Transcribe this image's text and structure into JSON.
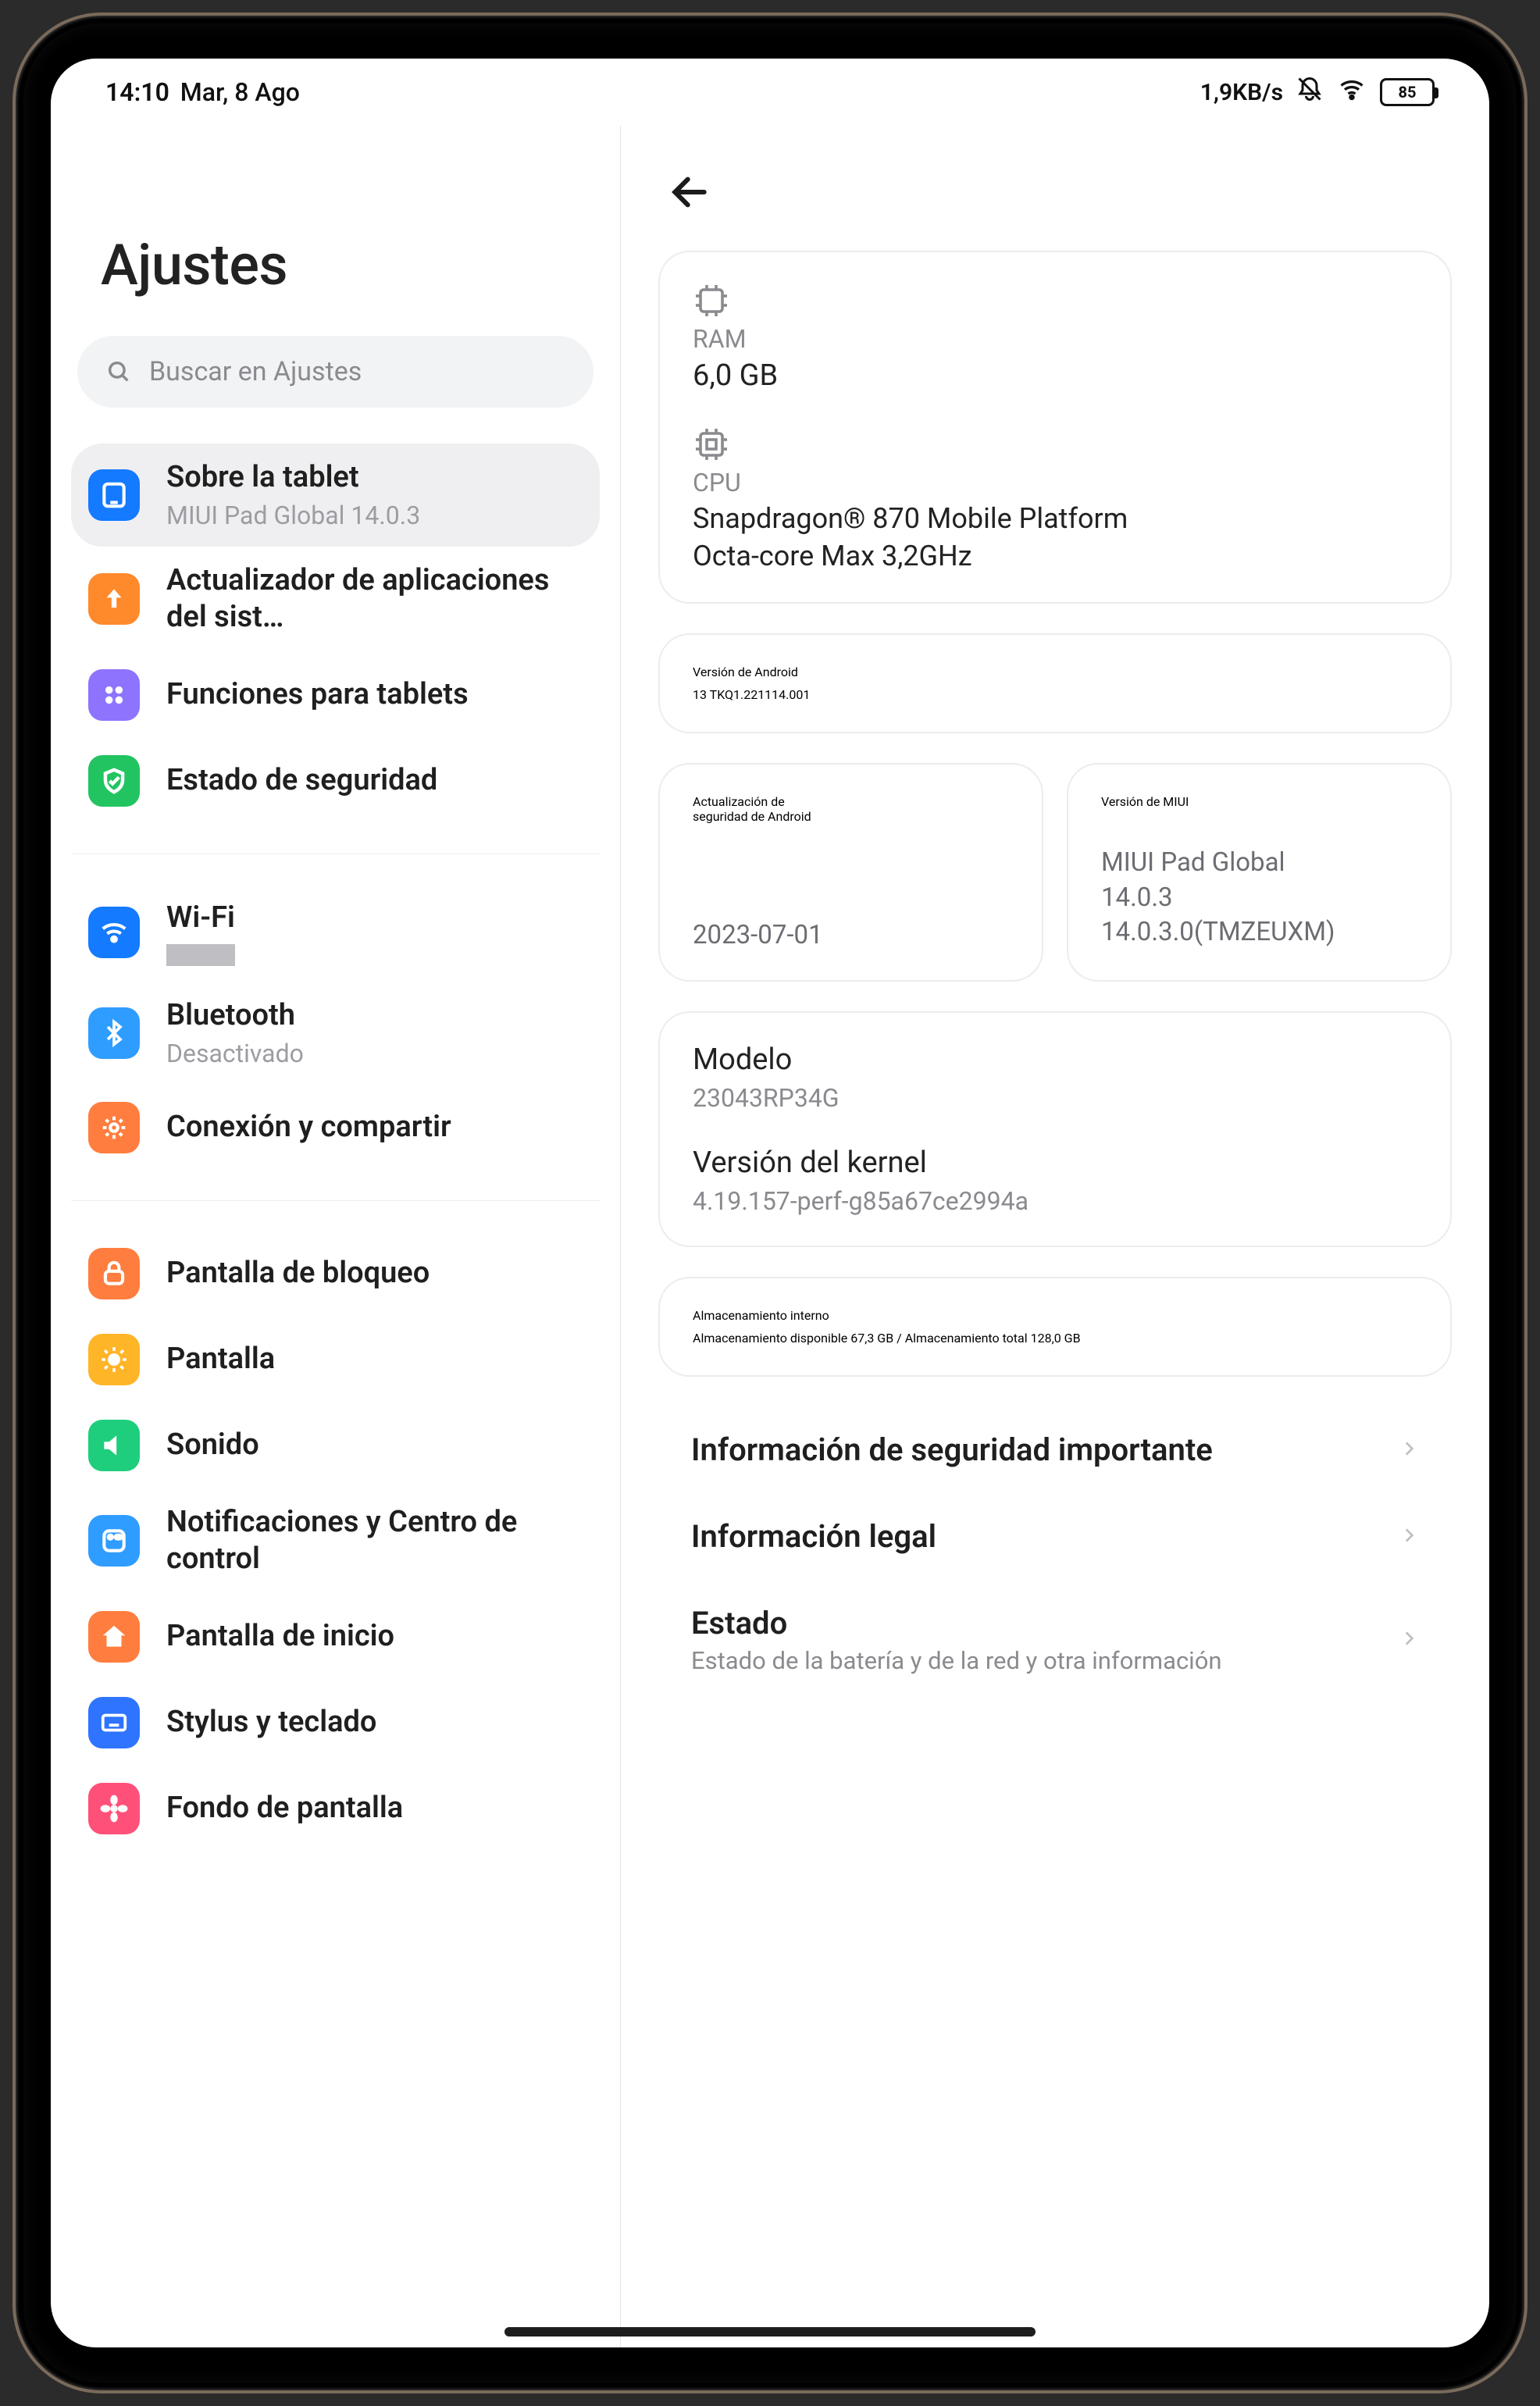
{
  "status": {
    "clock": "14:10",
    "date": "Mar, 8 Ago",
    "net_speed": "1,9KB/s",
    "battery": "85"
  },
  "sidebar": {
    "title": "Ajustes",
    "search_placeholder": "Buscar en Ajustes",
    "items": [
      {
        "label": "Sobre la tablet",
        "sub": "MIUI Pad Global 14.0.3"
      },
      {
        "label": "Actualizador de aplicaciones del sist…"
      },
      {
        "label": "Funciones para tablets"
      },
      {
        "label": "Estado de seguridad"
      },
      {
        "label": "Wi-Fi"
      },
      {
        "label": "Bluetooth",
        "sub": "Desactivado"
      },
      {
        "label": "Conexión y compartir"
      },
      {
        "label": "Pantalla de bloqueo"
      },
      {
        "label": "Pantalla"
      },
      {
        "label": "Sonido"
      },
      {
        "label": "Notificaciones y Centro de control"
      },
      {
        "label": "Pantalla de inicio"
      },
      {
        "label": "Stylus y teclado"
      },
      {
        "label": "Fondo de pantalla"
      }
    ]
  },
  "specs": {
    "ram_label": "RAM",
    "ram_value": "6,0 GB",
    "cpu_label": "CPU",
    "cpu_line1": "Snapdragon® 870 Mobile Platform",
    "cpu_line2": "Octa-core Max 3,2GHz"
  },
  "android": {
    "title": "Versión de Android",
    "value": "13 TKQ1.221114.001"
  },
  "security_update": {
    "title1": "Actualización de",
    "title2": "seguridad de Android",
    "value": "2023-07-01"
  },
  "miui": {
    "title": "Versión de MIUI",
    "line1": "MIUI Pad Global",
    "line2": "14.0.3",
    "line3": "14.0.3.0(TMZEUXM)"
  },
  "model": {
    "title": "Modelo",
    "value": "23043RP34G",
    "kernel_title": "Versión del kernel",
    "kernel_value": "4.19.157-perf-g85a67ce2994a"
  },
  "storage": {
    "title": "Almacenamiento interno",
    "sub": "Almacenamiento disponible  67,3 GB / Almacenamiento total 128,0 GB"
  },
  "links": {
    "security_info": "Información de seguridad importante",
    "legal_info": "Información legal",
    "state_title": "Estado",
    "state_sub": "Estado de la batería y de la red y otra información"
  }
}
